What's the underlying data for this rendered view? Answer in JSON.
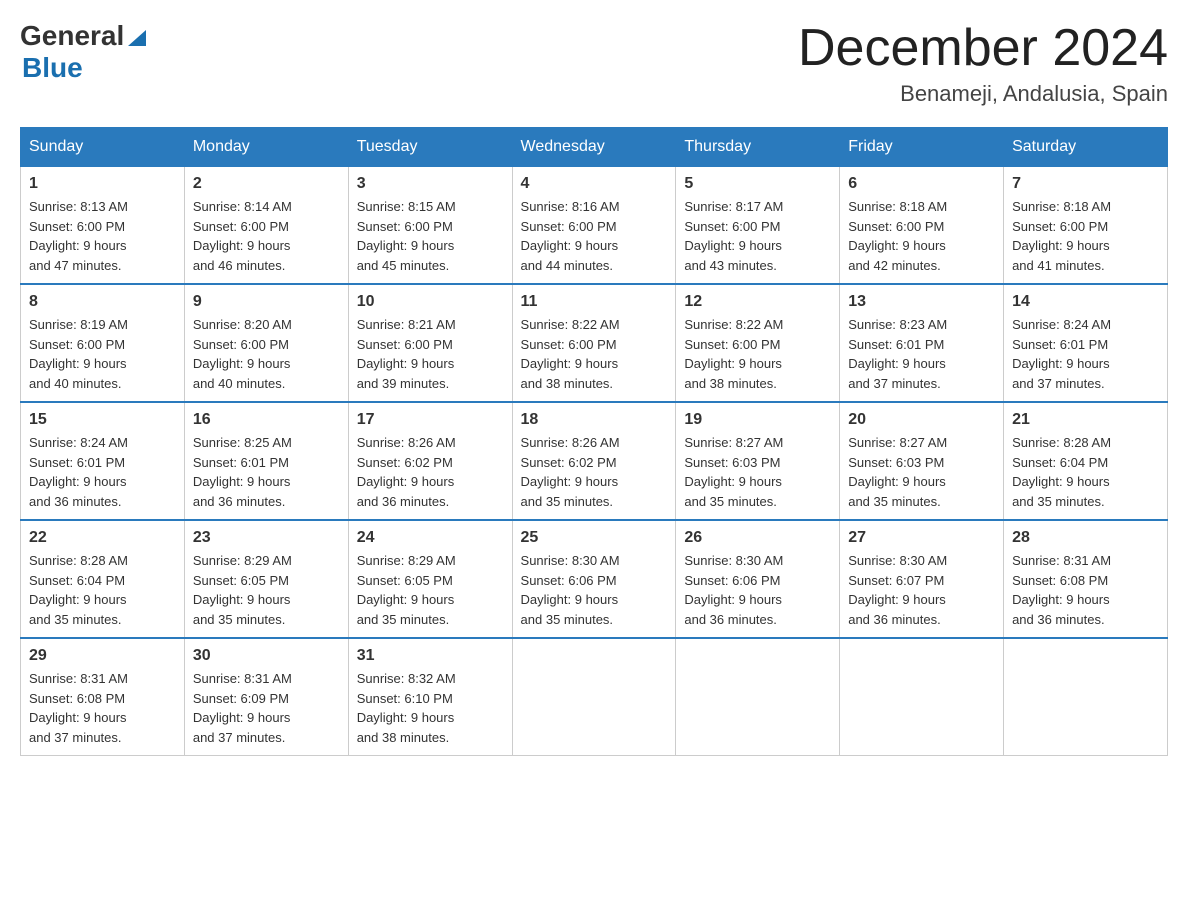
{
  "header": {
    "logo_general": "General",
    "logo_blue": "Blue",
    "title": "December 2024",
    "location": "Benameji, Andalusia, Spain"
  },
  "days_of_week": [
    "Sunday",
    "Monday",
    "Tuesday",
    "Wednesday",
    "Thursday",
    "Friday",
    "Saturday"
  ],
  "weeks": [
    [
      {
        "day": "1",
        "sunrise": "8:13 AM",
        "sunset": "6:00 PM",
        "daylight": "9 hours and 47 minutes."
      },
      {
        "day": "2",
        "sunrise": "8:14 AM",
        "sunset": "6:00 PM",
        "daylight": "9 hours and 46 minutes."
      },
      {
        "day": "3",
        "sunrise": "8:15 AM",
        "sunset": "6:00 PM",
        "daylight": "9 hours and 45 minutes."
      },
      {
        "day": "4",
        "sunrise": "8:16 AM",
        "sunset": "6:00 PM",
        "daylight": "9 hours and 44 minutes."
      },
      {
        "day": "5",
        "sunrise": "8:17 AM",
        "sunset": "6:00 PM",
        "daylight": "9 hours and 43 minutes."
      },
      {
        "day": "6",
        "sunrise": "8:18 AM",
        "sunset": "6:00 PM",
        "daylight": "9 hours and 42 minutes."
      },
      {
        "day": "7",
        "sunrise": "8:18 AM",
        "sunset": "6:00 PM",
        "daylight": "9 hours and 41 minutes."
      }
    ],
    [
      {
        "day": "8",
        "sunrise": "8:19 AM",
        "sunset": "6:00 PM",
        "daylight": "9 hours and 40 minutes."
      },
      {
        "day": "9",
        "sunrise": "8:20 AM",
        "sunset": "6:00 PM",
        "daylight": "9 hours and 40 minutes."
      },
      {
        "day": "10",
        "sunrise": "8:21 AM",
        "sunset": "6:00 PM",
        "daylight": "9 hours and 39 minutes."
      },
      {
        "day": "11",
        "sunrise": "8:22 AM",
        "sunset": "6:00 PM",
        "daylight": "9 hours and 38 minutes."
      },
      {
        "day": "12",
        "sunrise": "8:22 AM",
        "sunset": "6:00 PM",
        "daylight": "9 hours and 38 minutes."
      },
      {
        "day": "13",
        "sunrise": "8:23 AM",
        "sunset": "6:01 PM",
        "daylight": "9 hours and 37 minutes."
      },
      {
        "day": "14",
        "sunrise": "8:24 AM",
        "sunset": "6:01 PM",
        "daylight": "9 hours and 37 minutes."
      }
    ],
    [
      {
        "day": "15",
        "sunrise": "8:24 AM",
        "sunset": "6:01 PM",
        "daylight": "9 hours and 36 minutes."
      },
      {
        "day": "16",
        "sunrise": "8:25 AM",
        "sunset": "6:01 PM",
        "daylight": "9 hours and 36 minutes."
      },
      {
        "day": "17",
        "sunrise": "8:26 AM",
        "sunset": "6:02 PM",
        "daylight": "9 hours and 36 minutes."
      },
      {
        "day": "18",
        "sunrise": "8:26 AM",
        "sunset": "6:02 PM",
        "daylight": "9 hours and 35 minutes."
      },
      {
        "day": "19",
        "sunrise": "8:27 AM",
        "sunset": "6:03 PM",
        "daylight": "9 hours and 35 minutes."
      },
      {
        "day": "20",
        "sunrise": "8:27 AM",
        "sunset": "6:03 PM",
        "daylight": "9 hours and 35 minutes."
      },
      {
        "day": "21",
        "sunrise": "8:28 AM",
        "sunset": "6:04 PM",
        "daylight": "9 hours and 35 minutes."
      }
    ],
    [
      {
        "day": "22",
        "sunrise": "8:28 AM",
        "sunset": "6:04 PM",
        "daylight": "9 hours and 35 minutes."
      },
      {
        "day": "23",
        "sunrise": "8:29 AM",
        "sunset": "6:05 PM",
        "daylight": "9 hours and 35 minutes."
      },
      {
        "day": "24",
        "sunrise": "8:29 AM",
        "sunset": "6:05 PM",
        "daylight": "9 hours and 35 minutes."
      },
      {
        "day": "25",
        "sunrise": "8:30 AM",
        "sunset": "6:06 PM",
        "daylight": "9 hours and 35 minutes."
      },
      {
        "day": "26",
        "sunrise": "8:30 AM",
        "sunset": "6:06 PM",
        "daylight": "9 hours and 36 minutes."
      },
      {
        "day": "27",
        "sunrise": "8:30 AM",
        "sunset": "6:07 PM",
        "daylight": "9 hours and 36 minutes."
      },
      {
        "day": "28",
        "sunrise": "8:31 AM",
        "sunset": "6:08 PM",
        "daylight": "9 hours and 36 minutes."
      }
    ],
    [
      {
        "day": "29",
        "sunrise": "8:31 AM",
        "sunset": "6:08 PM",
        "daylight": "9 hours and 37 minutes."
      },
      {
        "day": "30",
        "sunrise": "8:31 AM",
        "sunset": "6:09 PM",
        "daylight": "9 hours and 37 minutes."
      },
      {
        "day": "31",
        "sunrise": "8:32 AM",
        "sunset": "6:10 PM",
        "daylight": "9 hours and 38 minutes."
      },
      null,
      null,
      null,
      null
    ]
  ],
  "labels": {
    "sunrise": "Sunrise:",
    "sunset": "Sunset:",
    "daylight": "Daylight:"
  }
}
